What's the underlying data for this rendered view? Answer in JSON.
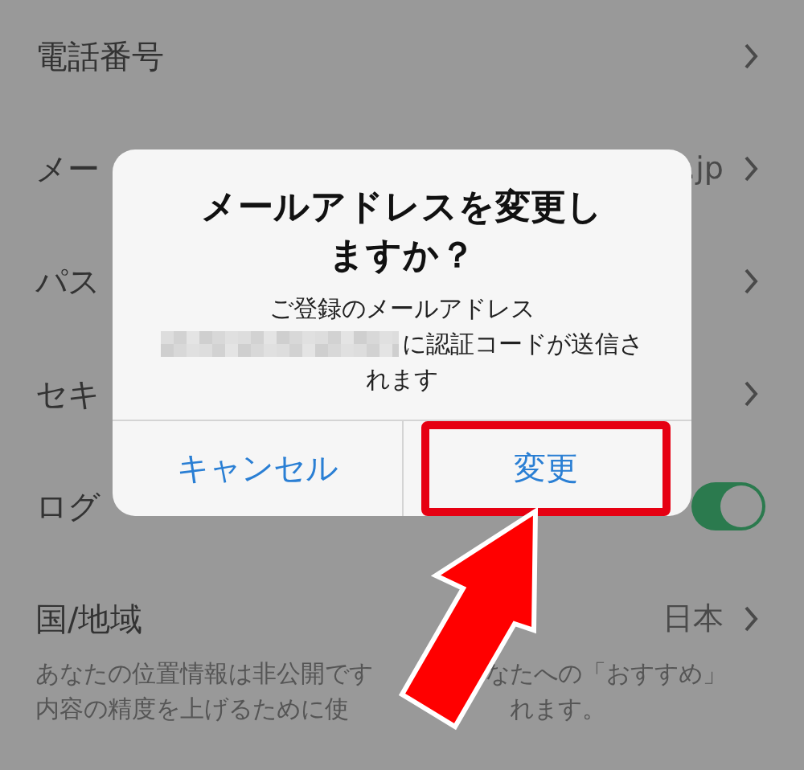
{
  "rows": [
    {
      "label": "電話番号",
      "kind": "link"
    },
    {
      "label": "メー",
      "value": ".jp",
      "kind": "link"
    },
    {
      "label": "パス",
      "kind": "link"
    },
    {
      "label": "セキ",
      "kind": "link"
    },
    {
      "label": "ログ",
      "kind": "toggle",
      "on": true
    },
    {
      "label": "国/地域",
      "value": "日本",
      "kind": "link",
      "note": [
        [
          "あなたの位置情報は非公開です",
          "なたへの「おすすめ」"
        ],
        [
          "内容の精度を上げるために使",
          "れます。"
        ]
      ]
    }
  ],
  "dialog": {
    "title": "メールアドレスを変更しますか？",
    "message": [
      {
        "text": "ご登録のメールアドレス",
        "redacted": false
      },
      {
        "text": "に認証コードが送信さ",
        "redacted": true
      },
      {
        "text": "れます",
        "redacted": false
      }
    ],
    "buttons": [
      {
        "label": "キャンセル",
        "highlighted": false
      },
      {
        "label": "変更",
        "highlighted": true
      }
    ]
  }
}
